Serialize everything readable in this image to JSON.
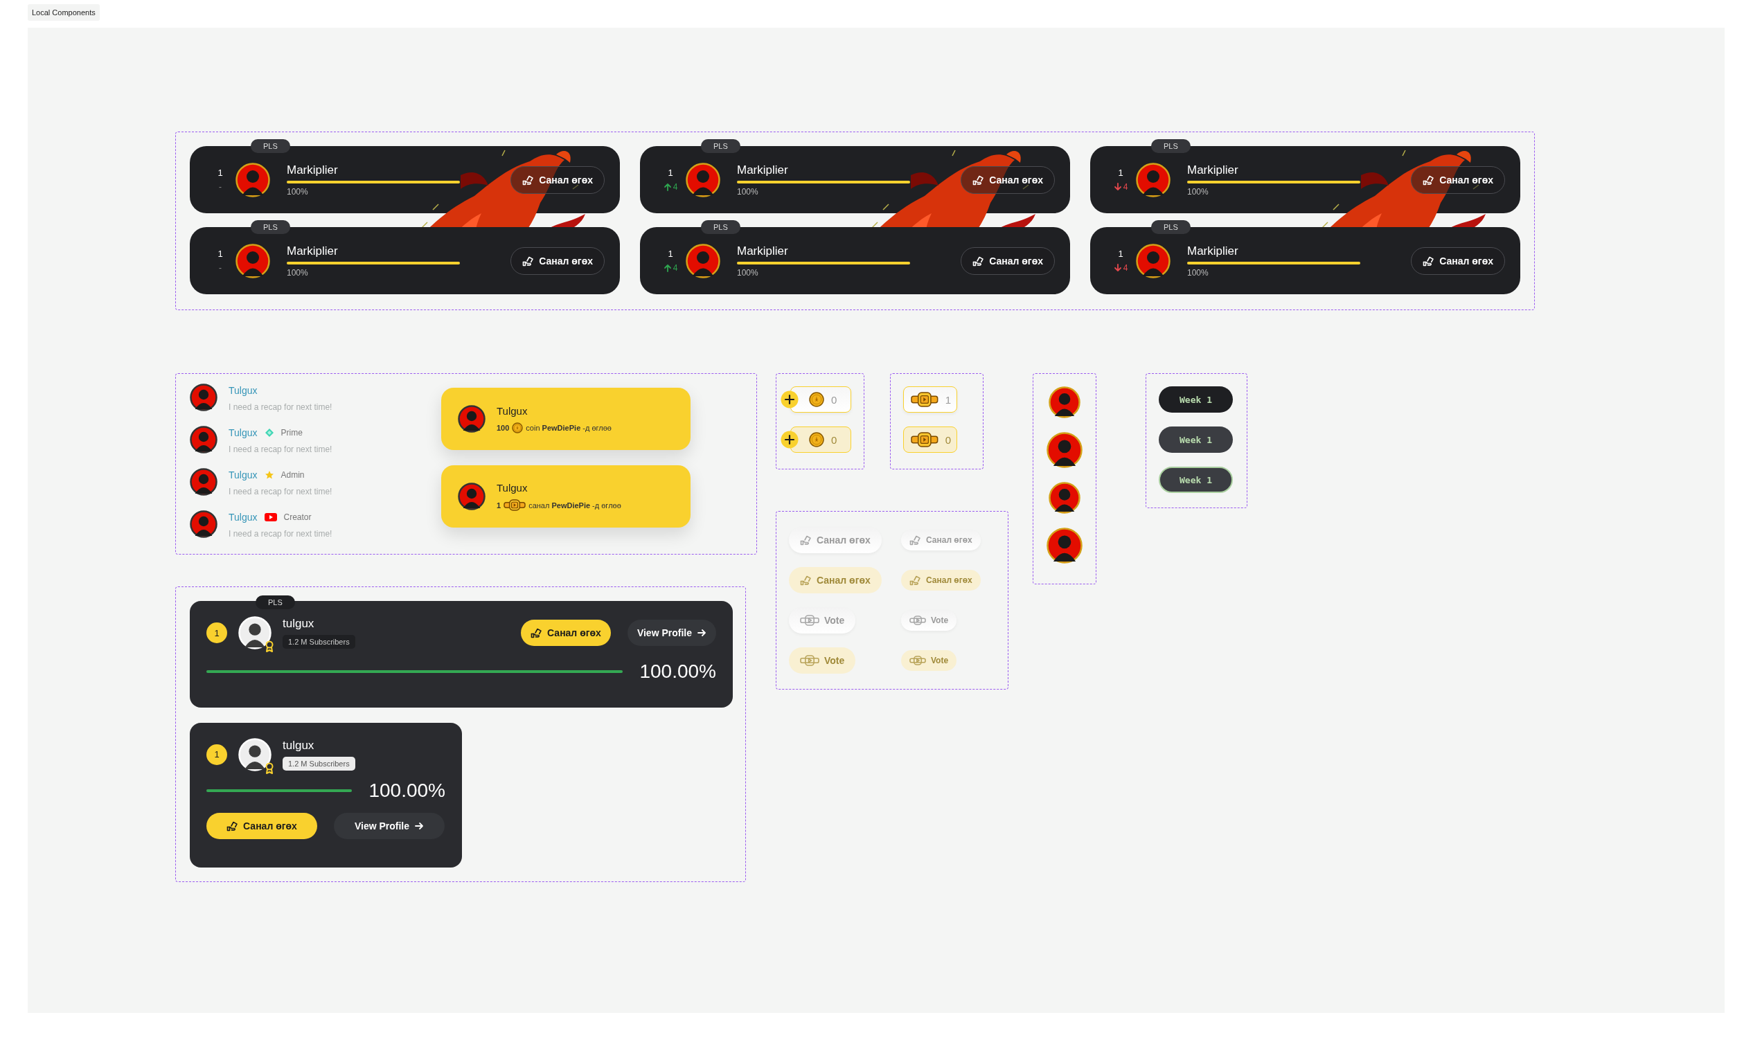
{
  "canvas": {
    "label": "Local Components"
  },
  "leaderboard": {
    "columns": [
      {
        "cards": [
          {
            "badge": "PLS",
            "rank": "1",
            "change": {
              "up": false,
              "down": false,
              "text": "-"
            },
            "name": "Markiplier",
            "level": 1,
            "percent": "100%",
            "button": "Санал өгөх",
            "flames": true
          },
          {
            "badge": "PLS",
            "rank": "1",
            "change": {
              "up": false,
              "down": false,
              "text": "-"
            },
            "name": "Markiplier",
            "level": 1,
            "percent": "100%",
            "button": "Санал өгөх",
            "flames": false
          }
        ]
      },
      {
        "cards": [
          {
            "badge": "PLS",
            "rank": "1",
            "change": {
              "up": true,
              "down": false,
              "text": "4"
            },
            "name": "Markiplier",
            "level": 1,
            "percent": "100%",
            "button": "Санал өгөх",
            "flames": true
          },
          {
            "badge": "PLS",
            "rank": "1",
            "change": {
              "up": true,
              "down": false,
              "text": "4"
            },
            "name": "Markiplier",
            "level": 1,
            "percent": "100%",
            "button": "Санал өгөх",
            "flames": false
          }
        ]
      },
      {
        "cards": [
          {
            "badge": "PLS",
            "rank": "1",
            "change": {
              "up": false,
              "down": true,
              "text": "4"
            },
            "name": "Markiplier",
            "level": 1,
            "percent": "100%",
            "button": "Санал өгөх",
            "flames": true
          },
          {
            "badge": "PLS",
            "rank": "1",
            "change": {
              "up": false,
              "down": true,
              "text": "4"
            },
            "name": "Markiplier",
            "level": 1,
            "percent": "100%",
            "button": "Санал өгөх",
            "flames": false
          }
        ]
      }
    ]
  },
  "chat": {
    "messages": [
      {
        "name": "Tulgux",
        "message": "I need a recap for next time!"
      },
      {
        "name": "Tulgux",
        "role": {
          "kind": "prime",
          "label": "Prime"
        },
        "message": "I need a recap for next time!"
      },
      {
        "name": "Tulgux",
        "role": {
          "kind": "admin",
          "label": "Admin"
        },
        "message": "I need a recap for next time!"
      },
      {
        "name": "Tulgux",
        "role": {
          "kind": "creator",
          "label": "Creator"
        },
        "message": "I need a recap for next time!"
      }
    ]
  },
  "gift_notifications": [
    {
      "name": "Tulgux",
      "kind": "coin",
      "amount": "100",
      "text": "coin **PewDiePie** -д өглөө"
    },
    {
      "name": "Tulgux",
      "kind": "vote",
      "amount": "1",
      "text": "санал **PewDiePie** -д өглөө"
    }
  ],
  "coin_counters": [
    {
      "tinted": false,
      "value": "0"
    },
    {
      "tinted": true,
      "value": "0"
    }
  ],
  "vote_counters": [
    {
      "tinted": false,
      "value": "1"
    },
    {
      "tinted": true,
      "value": "0"
    }
  ],
  "week_chips": [
    {
      "label": "Week 1",
      "hovered": false,
      "selected": false
    },
    {
      "label": "Week 1",
      "hovered": true,
      "selected": false
    },
    {
      "label": "Week 1",
      "hovered": true,
      "selected": true
    }
  ],
  "ghost_buttons": [
    {
      "label": "Санал өгөх",
      "kind": "offer",
      "tinted": false,
      "compact": false
    },
    {
      "label": "Санал өгөх",
      "kind": "offer",
      "tinted": false,
      "compact": true
    },
    {
      "label": "Санал өгөх",
      "kind": "offer",
      "tinted": true,
      "compact": false
    },
    {
      "label": "Санал өгөх",
      "kind": "offer",
      "tinted": true,
      "compact": true
    },
    {
      "label": "Vote",
      "kind": "vote",
      "tinted": false,
      "compact": false
    },
    {
      "label": "Vote",
      "kind": "vote",
      "tinted": false,
      "compact": true
    },
    {
      "label": "Vote",
      "kind": "vote",
      "tinted": true,
      "compact": false
    },
    {
      "label": "Vote",
      "kind": "vote",
      "tinted": true,
      "compact": true
    }
  ],
  "profile_cards": [
    {
      "compact": false,
      "badge": "PLS",
      "rank": "1",
      "name": "tulgux",
      "subscribers": "1.2 M Subscribers",
      "subscribers_light": false,
      "level": 1,
      "percent": "100.00%",
      "vote_button": "Санал өгөх",
      "profile_button": "View Profile"
    },
    {
      "compact": true,
      "rank": "1",
      "name": "tulgux",
      "subscribers": "1.2 M Subscribers",
      "subscribers_light": true,
      "level": 1,
      "percent": "100.00%",
      "vote_button": "Санал өгөх",
      "profile_button": "View Profile"
    }
  ]
}
